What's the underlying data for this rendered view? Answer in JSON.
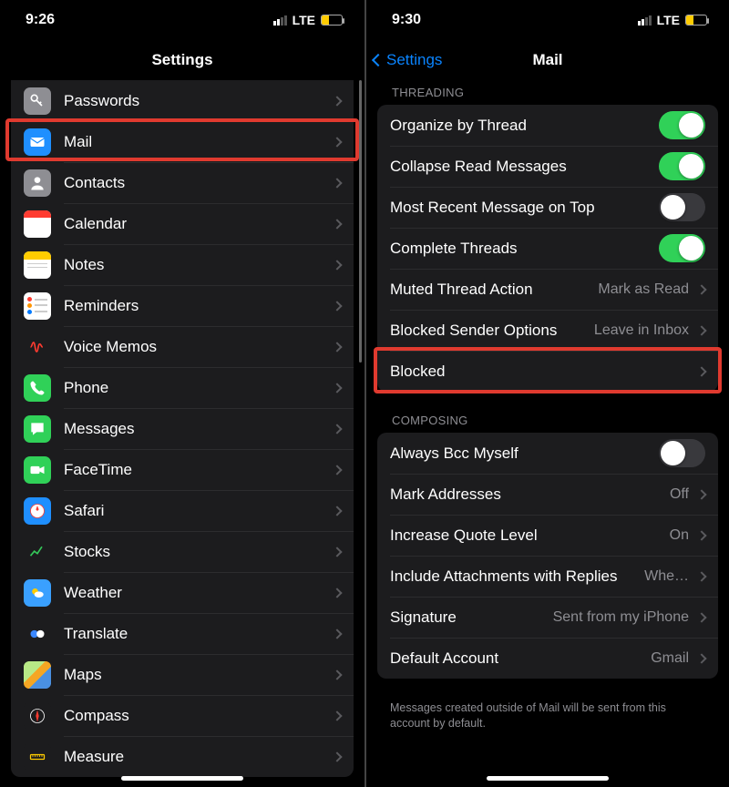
{
  "left": {
    "time": "9:26",
    "carrier": "LTE",
    "title": "Settings",
    "apps": [
      {
        "name": "Passwords",
        "color": "#8e8e93",
        "glyph": "key"
      },
      {
        "name": "Mail",
        "color": "#1f8fff",
        "glyph": "envelope",
        "highlight": true
      },
      {
        "name": "Contacts",
        "color": "#8e8e93",
        "glyph": "person"
      },
      {
        "name": "Calendar",
        "color": "#ffffff",
        "glyph": "calendar"
      },
      {
        "name": "Notes",
        "color": "#ffffff",
        "glyph": "notes"
      },
      {
        "name": "Reminders",
        "color": "#ffffff",
        "glyph": "reminders"
      },
      {
        "name": "Voice Memos",
        "color": "#1c1c1e",
        "glyph": "voice"
      },
      {
        "name": "Phone",
        "color": "#30d158",
        "glyph": "phone"
      },
      {
        "name": "Messages",
        "color": "#30d158",
        "glyph": "bubble"
      },
      {
        "name": "FaceTime",
        "color": "#30d158",
        "glyph": "video"
      },
      {
        "name": "Safari",
        "color": "#1f8fff",
        "glyph": "compass"
      },
      {
        "name": "Stocks",
        "color": "#1c1c1e",
        "glyph": "stocks"
      },
      {
        "name": "Weather",
        "color": "#3aa0ff",
        "glyph": "weather"
      },
      {
        "name": "Translate",
        "color": "#1c1c1e",
        "glyph": "translate"
      },
      {
        "name": "Maps",
        "color": "#ffffff",
        "glyph": "maps"
      },
      {
        "name": "Compass",
        "color": "#1c1c1e",
        "glyph": "compass2"
      },
      {
        "name": "Measure",
        "color": "#1c1c1e",
        "glyph": "measure"
      }
    ]
  },
  "right": {
    "time": "9:30",
    "carrier": "LTE",
    "back": "Settings",
    "title": "Mail",
    "sections": {
      "threading_header": "THREADING",
      "threading": [
        {
          "label": "Organize by Thread",
          "toggle": true
        },
        {
          "label": "Collapse Read Messages",
          "toggle": true
        },
        {
          "label": "Most Recent Message on Top",
          "toggle": false
        },
        {
          "label": "Complete Threads",
          "toggle": true
        },
        {
          "label": "Muted Thread Action",
          "value": "Mark as Read",
          "chevron": true
        },
        {
          "label": "Blocked Sender Options",
          "value": "Leave in Inbox",
          "chevron": true
        },
        {
          "label": "Blocked",
          "chevron": true,
          "highlight": true
        }
      ],
      "composing_header": "COMPOSING",
      "composing": [
        {
          "label": "Always Bcc Myself",
          "toggle": false
        },
        {
          "label": "Mark Addresses",
          "value": "Off",
          "chevron": true
        },
        {
          "label": "Increase Quote Level",
          "value": "On",
          "chevron": true
        },
        {
          "label": "Include Attachments with Replies",
          "value": "Whe…",
          "chevron": true
        },
        {
          "label": "Signature",
          "value": "Sent from my iPhone",
          "chevron": true
        },
        {
          "label": "Default Account",
          "value": "Gmail",
          "chevron": true
        }
      ],
      "composing_footer": "Messages created outside of Mail will be sent from this account by default."
    }
  }
}
